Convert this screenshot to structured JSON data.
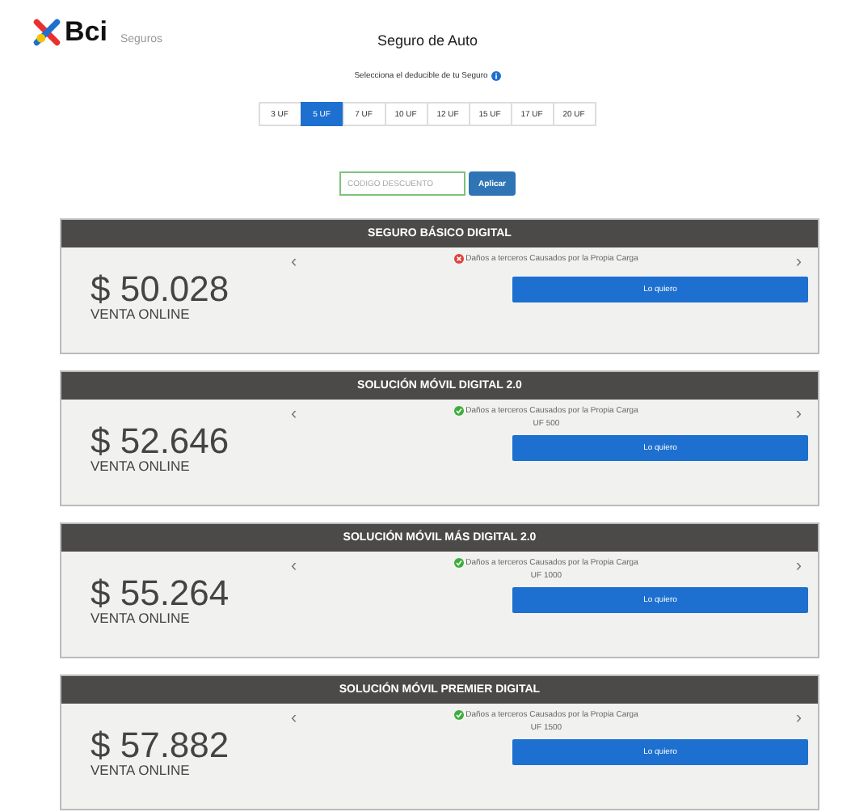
{
  "header": {
    "brand": "Bci",
    "brand_sub": "Seguros",
    "title": "Seguro de Auto"
  },
  "deductible": {
    "prompt": "Selecciona el deducible de tu Seguro",
    "options": [
      {
        "label": "3 UF",
        "selected": false
      },
      {
        "label": "5 UF",
        "selected": true
      },
      {
        "label": "7 UF",
        "selected": false
      },
      {
        "label": "10 UF",
        "selected": false
      },
      {
        "label": "12 UF",
        "selected": false
      },
      {
        "label": "15 UF",
        "selected": false
      },
      {
        "label": "17 UF",
        "selected": false
      },
      {
        "label": "20 UF",
        "selected": false
      }
    ]
  },
  "discount": {
    "placeholder": "CODIGO DESCUENTO",
    "button": "Aplicar"
  },
  "plans": [
    {
      "name": "SEGURO BÁSICO DIGITAL",
      "price": "$ 50.028",
      "price_note": "VENTA ONLINE",
      "prev": "‹",
      "next": "›",
      "coverage": "Daños a terceros Causados por la Propia Carga",
      "included": false,
      "button": "Lo quiero"
    },
    {
      "name": "SOLUCIÓN MÓVIL DIGITAL 2.0",
      "price": "$ 52.646",
      "price_note": "VENTA ONLINE",
      "prev": "‹",
      "next": "›",
      "coverage": "Daños a terceros Causados por la Propia Carga",
      "included": true,
      "limit": "UF 500",
      "button": "Lo quiero"
    },
    {
      "name": "SOLUCIÓN MÓVIL MÁS DIGITAL 2.0",
      "price": "$ 55.264",
      "price_note": "VENTA ONLINE",
      "prev": "‹",
      "next": "›",
      "coverage": "Daños a terceros Causados por la Propia Carga",
      "included": true,
      "limit": "UF 1000",
      "button": "Lo quiero"
    },
    {
      "name": "SOLUCIÓN MÓVIL PREMIER DIGITAL",
      "price": "$ 57.882",
      "price_note": "VENTA ONLINE",
      "prev": "‹",
      "next": "›",
      "coverage": "Daños a terceros Causados por la Propia Carga",
      "included": true,
      "limit": "UF 1500",
      "button": "Lo quiero"
    }
  ]
}
